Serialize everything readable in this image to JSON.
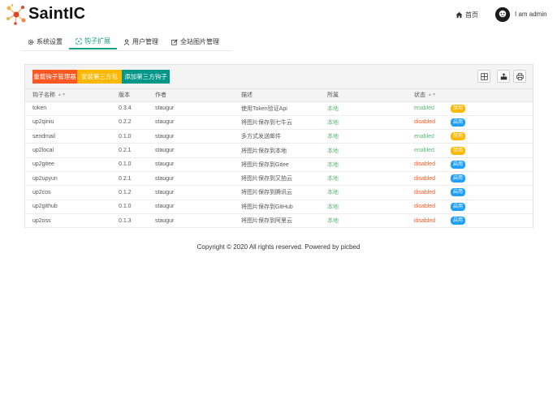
{
  "header": {
    "brand": "SaintIC",
    "home_label": "首页",
    "user_name": "I am admin"
  },
  "nav": {
    "items": [
      {
        "label": "系统设置",
        "icon": "gear-icon"
      },
      {
        "label": "钩子扩展",
        "icon": "hook-icon",
        "active": true
      },
      {
        "label": "用户管理",
        "icon": "user-icon"
      },
      {
        "label": "全站图片管理",
        "icon": "edit-icon"
      }
    ]
  },
  "toolbar": {
    "reload_label": "重载钩子管理器",
    "install_label": "安装第三方包",
    "add_label": "添加第三方钩子",
    "icons": [
      "columns-icon",
      "export-icon",
      "print-icon"
    ]
  },
  "table": {
    "headers": {
      "name": "钩子名称",
      "version": "版本",
      "author": "作者",
      "description": "描述",
      "belong": "所属",
      "status": "状态"
    },
    "rows": [
      {
        "name": "token",
        "version": "0.3.4",
        "author": "staugur",
        "description": "使用Token验证Api",
        "belong": "本地",
        "status": "enabled",
        "action": "禁用"
      },
      {
        "name": "up2qiniu",
        "version": "0.2.2",
        "author": "staugur",
        "description": "将图片保存到七牛云",
        "belong": "本地",
        "status": "disabled",
        "action": "启用"
      },
      {
        "name": "sendmail",
        "version": "0.1.0",
        "author": "staugur",
        "description": "多方式发送邮件",
        "belong": "本地",
        "status": "enabled",
        "action": "禁用"
      },
      {
        "name": "up2local",
        "version": "0.2.1",
        "author": "staugur",
        "description": "将图片保存到本地",
        "belong": "本地",
        "status": "enabled",
        "action": "禁用"
      },
      {
        "name": "up2gitee",
        "version": "0.1.0",
        "author": "staugur",
        "description": "将图片保存到Gitee",
        "belong": "本地",
        "status": "disabled",
        "action": "启用"
      },
      {
        "name": "up2upyun",
        "version": "0.2.1",
        "author": "staugur",
        "description": "将图片保存到又拍云",
        "belong": "本地",
        "status": "disabled",
        "action": "启用"
      },
      {
        "name": "up2cos",
        "version": "0.1.2",
        "author": "staugur",
        "description": "将图片保存到腾讯云",
        "belong": "本地",
        "status": "disabled",
        "action": "启用"
      },
      {
        "name": "up2github",
        "version": "0.1.0",
        "author": "staugur",
        "description": "将图片保存到GitHub",
        "belong": "本地",
        "status": "disabled",
        "action": "启用"
      },
      {
        "name": "up2oss",
        "version": "0.1.3",
        "author": "staugur",
        "description": "将图片保存到阿里云",
        "belong": "本地",
        "status": "disabled",
        "action": "启用"
      }
    ]
  },
  "footer": {
    "copyright": "Copyright © 2020 All rights reserved. Powered by picbed"
  },
  "colors": {
    "accent": "#1aa28a",
    "reload": "#ff5722",
    "install": "#ffb800",
    "add": "#009688",
    "enabled": "#5fb878",
    "disabled": "#ff5722",
    "enable_button": "#1e9fff",
    "disable_button": "#ffb800"
  }
}
